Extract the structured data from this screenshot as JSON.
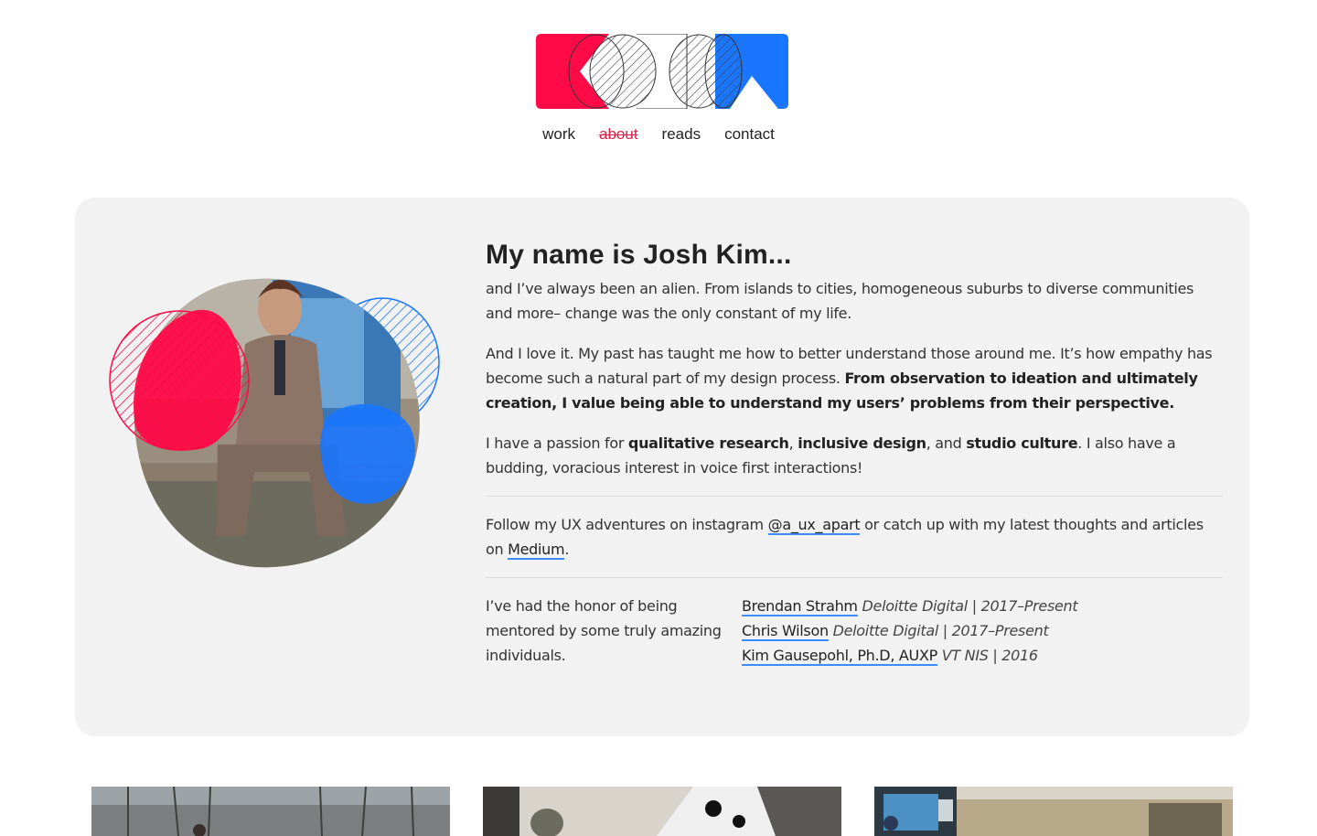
{
  "nav": {
    "items": [
      {
        "label": "work",
        "active": false
      },
      {
        "label": "about",
        "active": true
      },
      {
        "label": "reads",
        "active": false
      },
      {
        "label": "contact",
        "active": false
      }
    ]
  },
  "about": {
    "heading": "My name is Josh Kim...",
    "p1": "and I’ve always been an alien. From islands to cities, homogeneous suburbs to diverse communities and more– change was the only constant of my life.",
    "p2_a": "And I love it. My past has taught me how to better understand those around me. It’s how empathy has become such a natural part of my design process. ",
    "p2_b": "From observation to ideation and ultimately creation, I value being able to understand my users’ problems from their perspective.",
    "p3_a": "I have a passion for ",
    "p3_b": "qualitative research",
    "p3_c": ", ",
    "p3_d": "inclusive design",
    "p3_e": ", and ",
    "p3_f": "studio culture",
    "p3_g": ". I also have a budding, voracious interest in voice first interactions!",
    "follow_a": "Follow my UX adventures on instagram ",
    "instagram": "@a_ux_apart",
    "follow_b": " or catch up with my latest thoughts and articles on ",
    "medium": "Medium",
    "follow_c": ".",
    "mentors_intro": "I’ve had the honor of being mentored by some truly amazing individuals.",
    "mentors": [
      {
        "name": "Brendan Strahm",
        "role": "Deloitte Digital | 2017–Present"
      },
      {
        "name": "Chris Wilson",
        "role": "Deloitte Digital | 2017–Present"
      },
      {
        "name": "Kim Gausepohl, Ph.D, AUXP",
        "role": "VT NIS | 2016"
      }
    ]
  },
  "colors": {
    "accent_red": "#ff0a47",
    "accent_blue": "#1a76ff",
    "card_bg": "#f2f2f2"
  }
}
